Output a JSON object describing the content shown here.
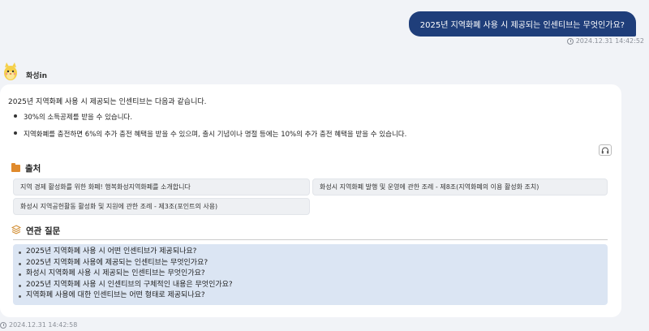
{
  "user_message": {
    "text": "2025년 지역화폐 사용 시 제공되는 인센티브는 무엇인가요?",
    "timestamp": "2024.12.31 14:42:52"
  },
  "bot": {
    "name": "화성in",
    "timestamp": "2024.12.31 14:42:58",
    "intro": "2025년 지역화폐 사용 시 제공되는 인센티브는 다음과 같습니다.",
    "bullets": [
      "30%의 소득공제를 받을 수 있습니다.",
      "지역화폐를 충전하면 6%의 추가 충전 혜택을 받을 수 있으며, 출시 기념이나 명절 등에는 10%의 추가 충전 혜택을 받을 수 있습니다."
    ],
    "sources_title": "출처",
    "sources": [
      "지역 경제 활성화를 위한 화폐! 행복화성지역화폐를 소개합니다",
      "화성시 지역화폐 발행 및 운영에 관한 조례 - 제8조(지역화폐의 이용 활성화 조치)",
      "화성시 지역공헌활동 활성화 및 지원에 관한 조례 - 제3조(포인트의 사용)"
    ],
    "related_title": "연관 질문",
    "related": [
      "2025년 지역화폐 사용 시 어떤 인센티브가 제공되나요?",
      "2025년 지역화폐 사용에 제공되는 인센티브는 무엇인가요?",
      "화성시 지역화폐 사용 시 제공되는 인센티브는 무엇인가요?",
      "2025년 지역화폐 사용 시 인센티브의 구체적인 내용은 무엇인가요?",
      "지역화폐 사용에 대한 인센티브는 어떤 형태로 제공되나요?"
    ]
  },
  "colors": {
    "user_bubble": "#1f3e7a",
    "related_bg": "#dbe5f3",
    "folder": "#e08a2c",
    "page_bg": "#f1f3f7"
  },
  "icons": [
    "clock-icon",
    "bot-avatar",
    "headphone-icon",
    "folder-icon",
    "layers-icon"
  ]
}
